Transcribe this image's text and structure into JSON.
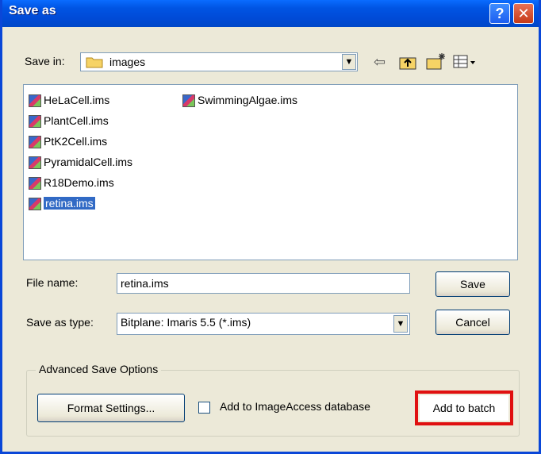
{
  "window": {
    "title": "Save as"
  },
  "titlebar": {
    "help_label": "?",
    "close_label": "✕"
  },
  "toolbar": {
    "save_in_label": "Save in:",
    "save_in_value": "images",
    "icons": [
      "back-arrow-icon",
      "up-folder-icon",
      "new-folder-icon",
      "view-menu-icon"
    ]
  },
  "files": [
    {
      "name": "HeLaCell.ims",
      "selected": false
    },
    {
      "name": "PlantCell.ims",
      "selected": false
    },
    {
      "name": "PtK2Cell.ims",
      "selected": false
    },
    {
      "name": "PyramidalCell.ims",
      "selected": false
    },
    {
      "name": "R18Demo.ims",
      "selected": false
    },
    {
      "name": "retina.ims",
      "selected": true
    },
    {
      "name": "SwimmingAlgae.ims",
      "selected": false
    }
  ],
  "form": {
    "file_name_label": "File name:",
    "file_name_value": "retina.ims",
    "save_type_label": "Save as type:",
    "save_type_value": "Bitplane: Imaris 5.5 (*.ims)",
    "save_button": "Save",
    "cancel_button": "Cancel"
  },
  "advanced": {
    "group_label": "Advanced Save Options",
    "format_settings_button": "Format Settings...",
    "imageaccess_label": "Add to ImageAccess database",
    "imageaccess_checked": false,
    "add_to_batch_button": "Add to batch"
  },
  "colors": {
    "highlight": "#e01010",
    "selection": "#316ac5",
    "titlebar": "#0054e3"
  }
}
